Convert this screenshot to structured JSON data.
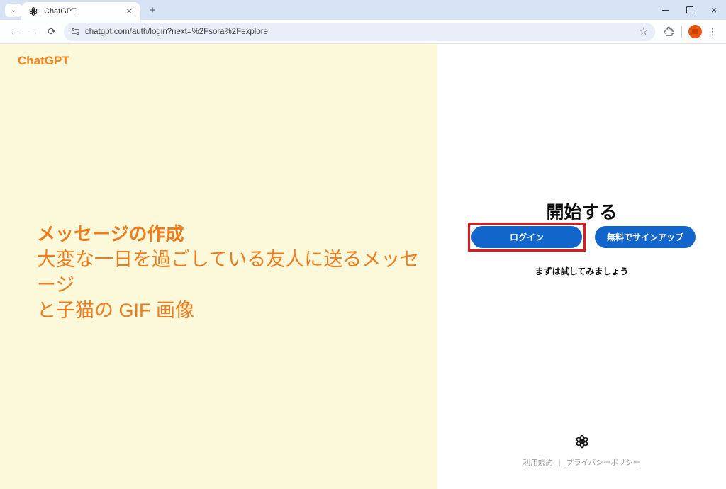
{
  "browser": {
    "tab_title": "ChatGPT",
    "url": "chatgpt.com/auth/login?next=%2Fsora%2Fexplore",
    "icons": {
      "tab_search": "⌄",
      "tab_close": "×",
      "new_tab": "+",
      "close_window": "×",
      "back": "←",
      "forward": "→",
      "reload": "⟳",
      "bookmark_star": "☆",
      "menu_kebab": "⋮"
    }
  },
  "left_panel": {
    "brand": "ChatGPT",
    "promo_heading": "メッセージの作成",
    "promo_line1": "大変な一日を過ごしている友人に送るメッセージ",
    "promo_line2": "と子猫の GIF 画像"
  },
  "right_panel": {
    "title": "開始する",
    "login_label": "ログイン",
    "signup_label": "無料でサインアップ",
    "caption": "まずは試してみましょう",
    "footer": {
      "terms": "利用規約",
      "separator": "|",
      "privacy": "プライバシーポリシー"
    }
  },
  "colors": {
    "accent_blue": "#1266cb",
    "annotation_red": "#e9151d",
    "brand_orange": "#f5821f",
    "promo_orange": "#ee7c1e",
    "left_bg": "#fbf9da",
    "tabstrip_bg": "#d7e2f5"
  }
}
